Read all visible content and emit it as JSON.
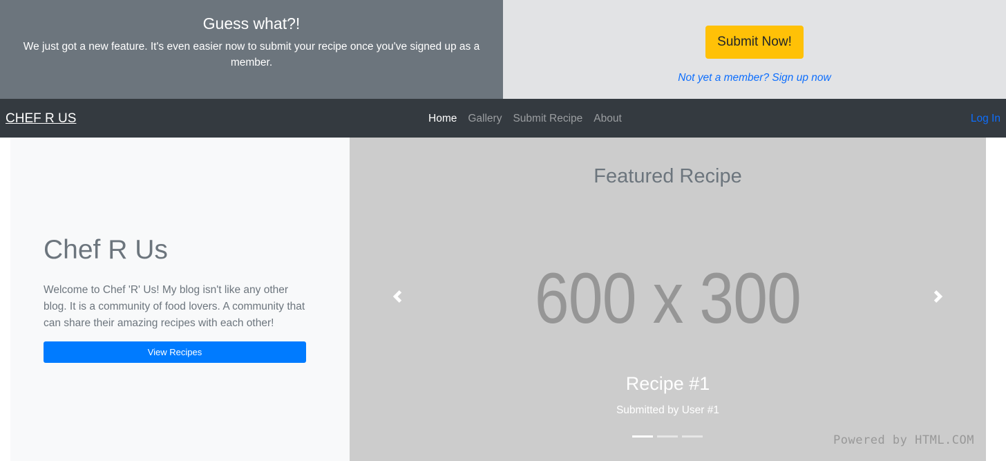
{
  "banner": {
    "title": "Guess what?!",
    "text": "We just got a new feature. It's even easier now to submit your recipe once you've signed up as a member.",
    "submit_label": "Submit Now!",
    "signup_label": "Not yet a member? Sign up now"
  },
  "navbar": {
    "brand": "CHEF R US",
    "links": [
      {
        "label": "Home",
        "active": true
      },
      {
        "label": "Gallery",
        "active": false
      },
      {
        "label": "Submit Recipe",
        "active": false
      },
      {
        "label": "About",
        "active": false
      }
    ],
    "login_label": "Log In"
  },
  "intro": {
    "title": "Chef R Us",
    "text": "Welcome to Chef 'R' Us! My blog isn't like any other blog. It is a community of food lovers. A community that can share their amazing recipes with each other!",
    "button_label": "View Recipes"
  },
  "featured": {
    "title": "Featured Recipe",
    "placeholder_text": "600 x 300",
    "prev_icon": "chevron-left-icon",
    "next_icon": "chevron-right-icon",
    "caption_title": "Recipe #1",
    "caption_text": "Submitted by User #1",
    "slide_count": 3,
    "active_slide": 1
  },
  "watermark": "Powered by HTML.COM",
  "colors": {
    "banner_left_bg": "#6c757d",
    "banner_right_bg": "#e2e3e5",
    "submit_bg": "#ffc107",
    "navbar_bg": "#343a40",
    "primary": "#007bff",
    "featured_bg": "#cccccc",
    "intro_bg": "#f8f9fa"
  }
}
